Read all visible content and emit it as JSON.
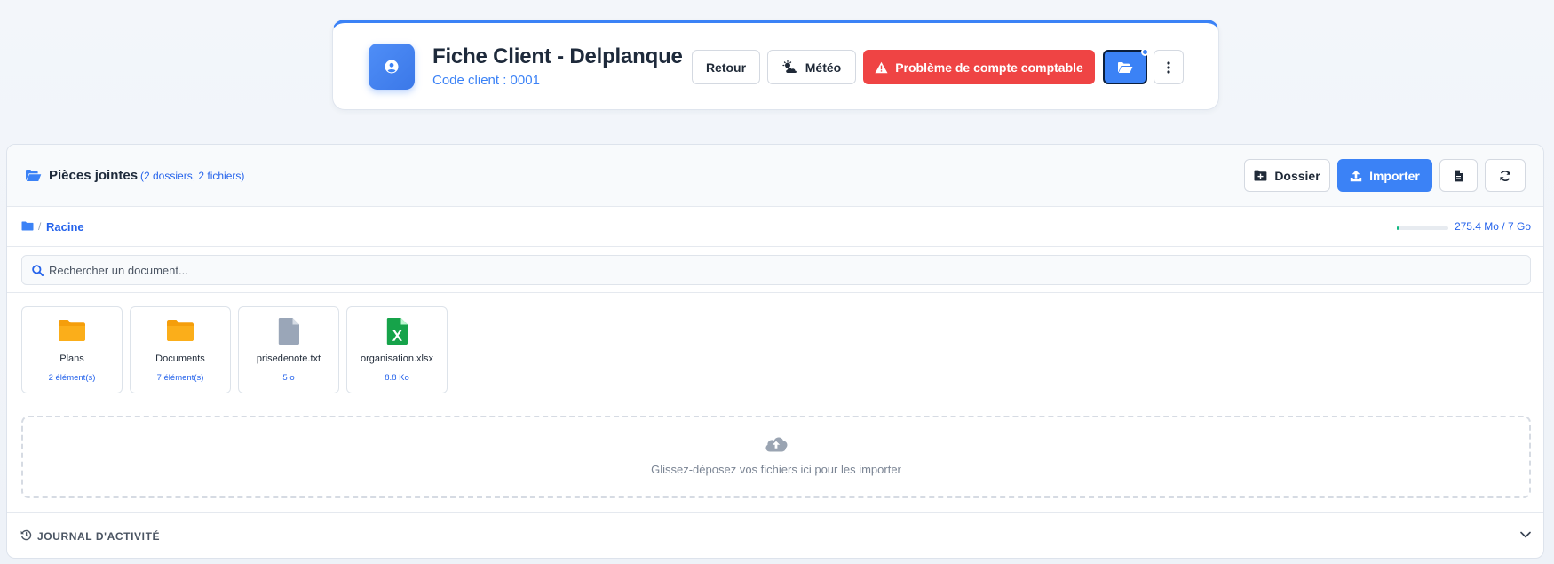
{
  "header": {
    "title": "Fiche Client - Delplanque",
    "subtitle": "Code client : 0001",
    "buttons": {
      "back": "Retour",
      "weather": "Météo",
      "alert": "Problème de compte comptable"
    },
    "accent_color": "#3b82f6",
    "danger_color": "#ef4444"
  },
  "attachments": {
    "title": "Pièces jointes",
    "summary": "(2 dossiers, 2 fichiers)",
    "toolbar": {
      "folder_label": "Dossier",
      "import_label": "Importer"
    },
    "breadcrumb": {
      "root": "Racine",
      "separator": "/"
    },
    "storage": {
      "text": "275.4 Mo / 7 Go",
      "used_fraction": 0.04
    },
    "search": {
      "placeholder": "Rechercher un document..."
    },
    "items": [
      {
        "name": "Plans",
        "meta": "2 élément(s)",
        "type": "folder"
      },
      {
        "name": "Documents",
        "meta": "7 élément(s)",
        "type": "folder"
      },
      {
        "name": "prisedenote.txt",
        "meta": "5 o",
        "type": "file-txt"
      },
      {
        "name": "organisation.xlsx",
        "meta": "8.8 Ko",
        "type": "file-xlsx"
      }
    ],
    "dropzone_text": "Glissez-déposez vos fichiers ici pour les importer"
  },
  "journal": {
    "label": "JOURNAL D'ACTIVITÉ"
  }
}
